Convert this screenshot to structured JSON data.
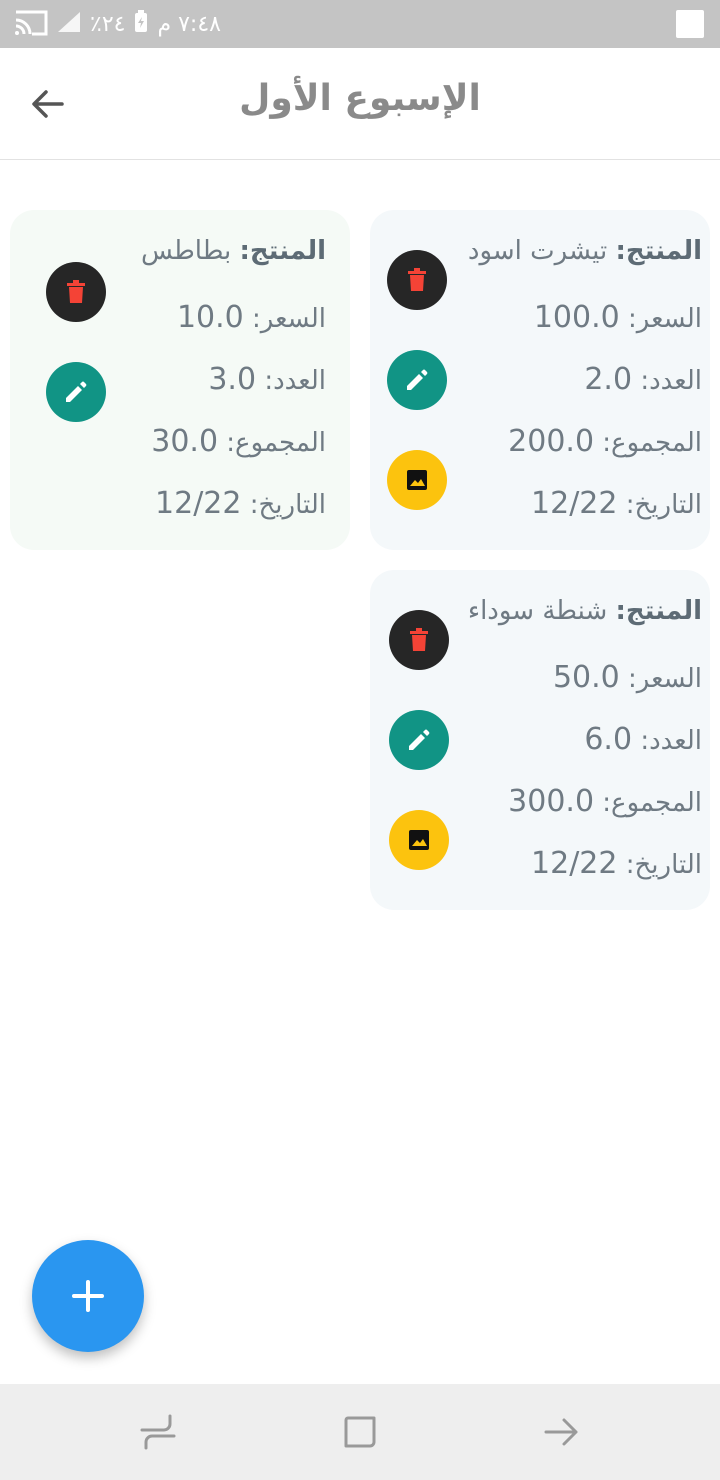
{
  "status_bar": {
    "time": "٧:٤٨ م",
    "battery": "٢٤٪"
  },
  "app_bar": {
    "title": "الإسبوع الأول",
    "back_icon": "arrow-left-icon"
  },
  "labels": {
    "product": "المنتج:",
    "price": "السعر:",
    "count": "العدد:",
    "total": "المجموع:",
    "date": "التاريخ:"
  },
  "products": [
    {
      "name": "تيشرت اسود",
      "price": "100.0",
      "count": "2.0",
      "total": "200.0",
      "date": "12/22",
      "has_image": true
    },
    {
      "name": "بطاطس",
      "price": "10.0",
      "count": "3.0",
      "total": "30.0",
      "date": "12/22",
      "has_image": false
    },
    {
      "name": "شنطة سوداء",
      "price": "50.0",
      "count": "6.0",
      "total": "300.0",
      "date": "12/22",
      "has_image": true
    }
  ],
  "icons": {
    "delete": "trash-icon",
    "edit": "pencil-icon",
    "image": "image-icon",
    "add": "plus-icon"
  },
  "colors": {
    "delete_bg": "#262626",
    "delete_fg": "#f44336",
    "edit_bg": "#119485",
    "image_bg": "#fcc30e",
    "fab": "#2a96f0",
    "status_bar": "#c4c4c4"
  }
}
